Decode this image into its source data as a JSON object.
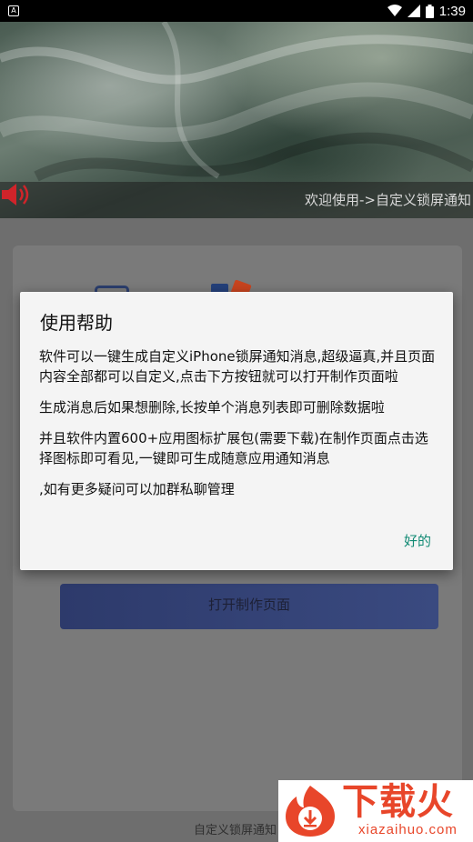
{
  "status_bar": {
    "notification_icon": "A",
    "time": "1:39",
    "icons": [
      "wifi-icon",
      "signal-icon",
      "battery-icon"
    ]
  },
  "header": {
    "ticker_text": "欢迎使用->自定义锁屏通知"
  },
  "background": {
    "button_label": "打开制作页面",
    "footer_text": "自定义锁屏通知"
  },
  "dialog": {
    "title": "使用帮助",
    "paragraphs": [
      "软件可以一键生成自定义iPhone锁屏通知消息,超级逼真,并且页面内容全部都可以自定义,点击下方按钮就可以打开制作页面啦",
      "生成消息后如果想删除,长按单个消息列表即可删除数据啦",
      "并且软件内置600+应用图标扩展包(需要下载)在制作页面点击选择图标即可看见,一键即可生成随意应用通知消息",
      ",如有更多疑问可以加群私聊管理"
    ],
    "ok_label": "好的"
  },
  "watermark": {
    "title": "下载火",
    "subtitle": "xiazaihuo.com"
  },
  "colors": {
    "accent": "#128a74",
    "watermark": "#e8462a",
    "button": "#2d3a6b"
  }
}
